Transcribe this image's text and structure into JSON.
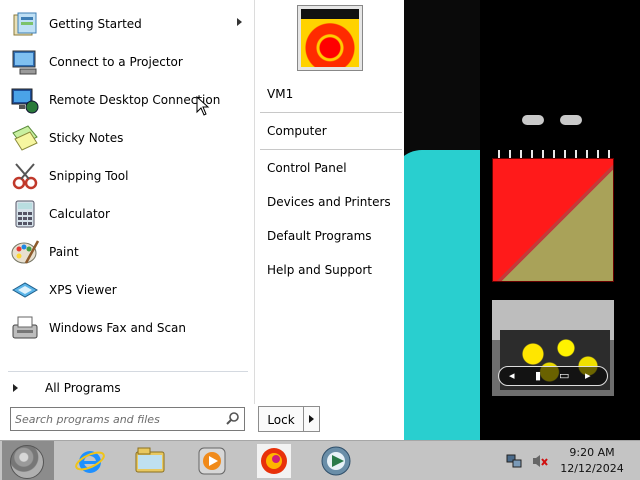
{
  "start_menu": {
    "programs": [
      {
        "label": "Getting Started",
        "icon": "getting-started-icon",
        "has_submenu": true
      },
      {
        "label": "Connect to a Projector",
        "icon": "projector-icon"
      },
      {
        "label": "Remote Desktop Connection",
        "icon": "remote-desktop-icon"
      },
      {
        "label": "Sticky Notes",
        "icon": "sticky-notes-icon"
      },
      {
        "label": "Snipping Tool",
        "icon": "snipping-tool-icon"
      },
      {
        "label": "Calculator",
        "icon": "calculator-icon"
      },
      {
        "label": "Paint",
        "icon": "paint-icon"
      },
      {
        "label": "XPS Viewer",
        "icon": "xps-viewer-icon"
      },
      {
        "label": "Windows Fax and Scan",
        "icon": "fax-scan-icon"
      }
    ],
    "all_programs": "All Programs",
    "search_placeholder": "Search programs and files",
    "lock_label": "Lock",
    "right_items": {
      "user": "VM1",
      "computer": "Computer",
      "control_panel": "Control Panel",
      "devices": "Devices and Printers",
      "default_programs": "Default Programs",
      "help": "Help and Support"
    }
  },
  "taskbar": {
    "pinned": [
      "start-orb-icon",
      "internet-explorer-icon",
      "windows-explorer-icon",
      "media-player-icon",
      "firefox-icon",
      "app-icon"
    ],
    "time": "9:20 AM",
    "date": "12/12/2024"
  },
  "colors": {
    "desktop_teal": "#29cfcf",
    "notepad_red": "#ff1a1a",
    "notepad_olive": "#a9a259",
    "taskbar": "#c4c4c4"
  }
}
